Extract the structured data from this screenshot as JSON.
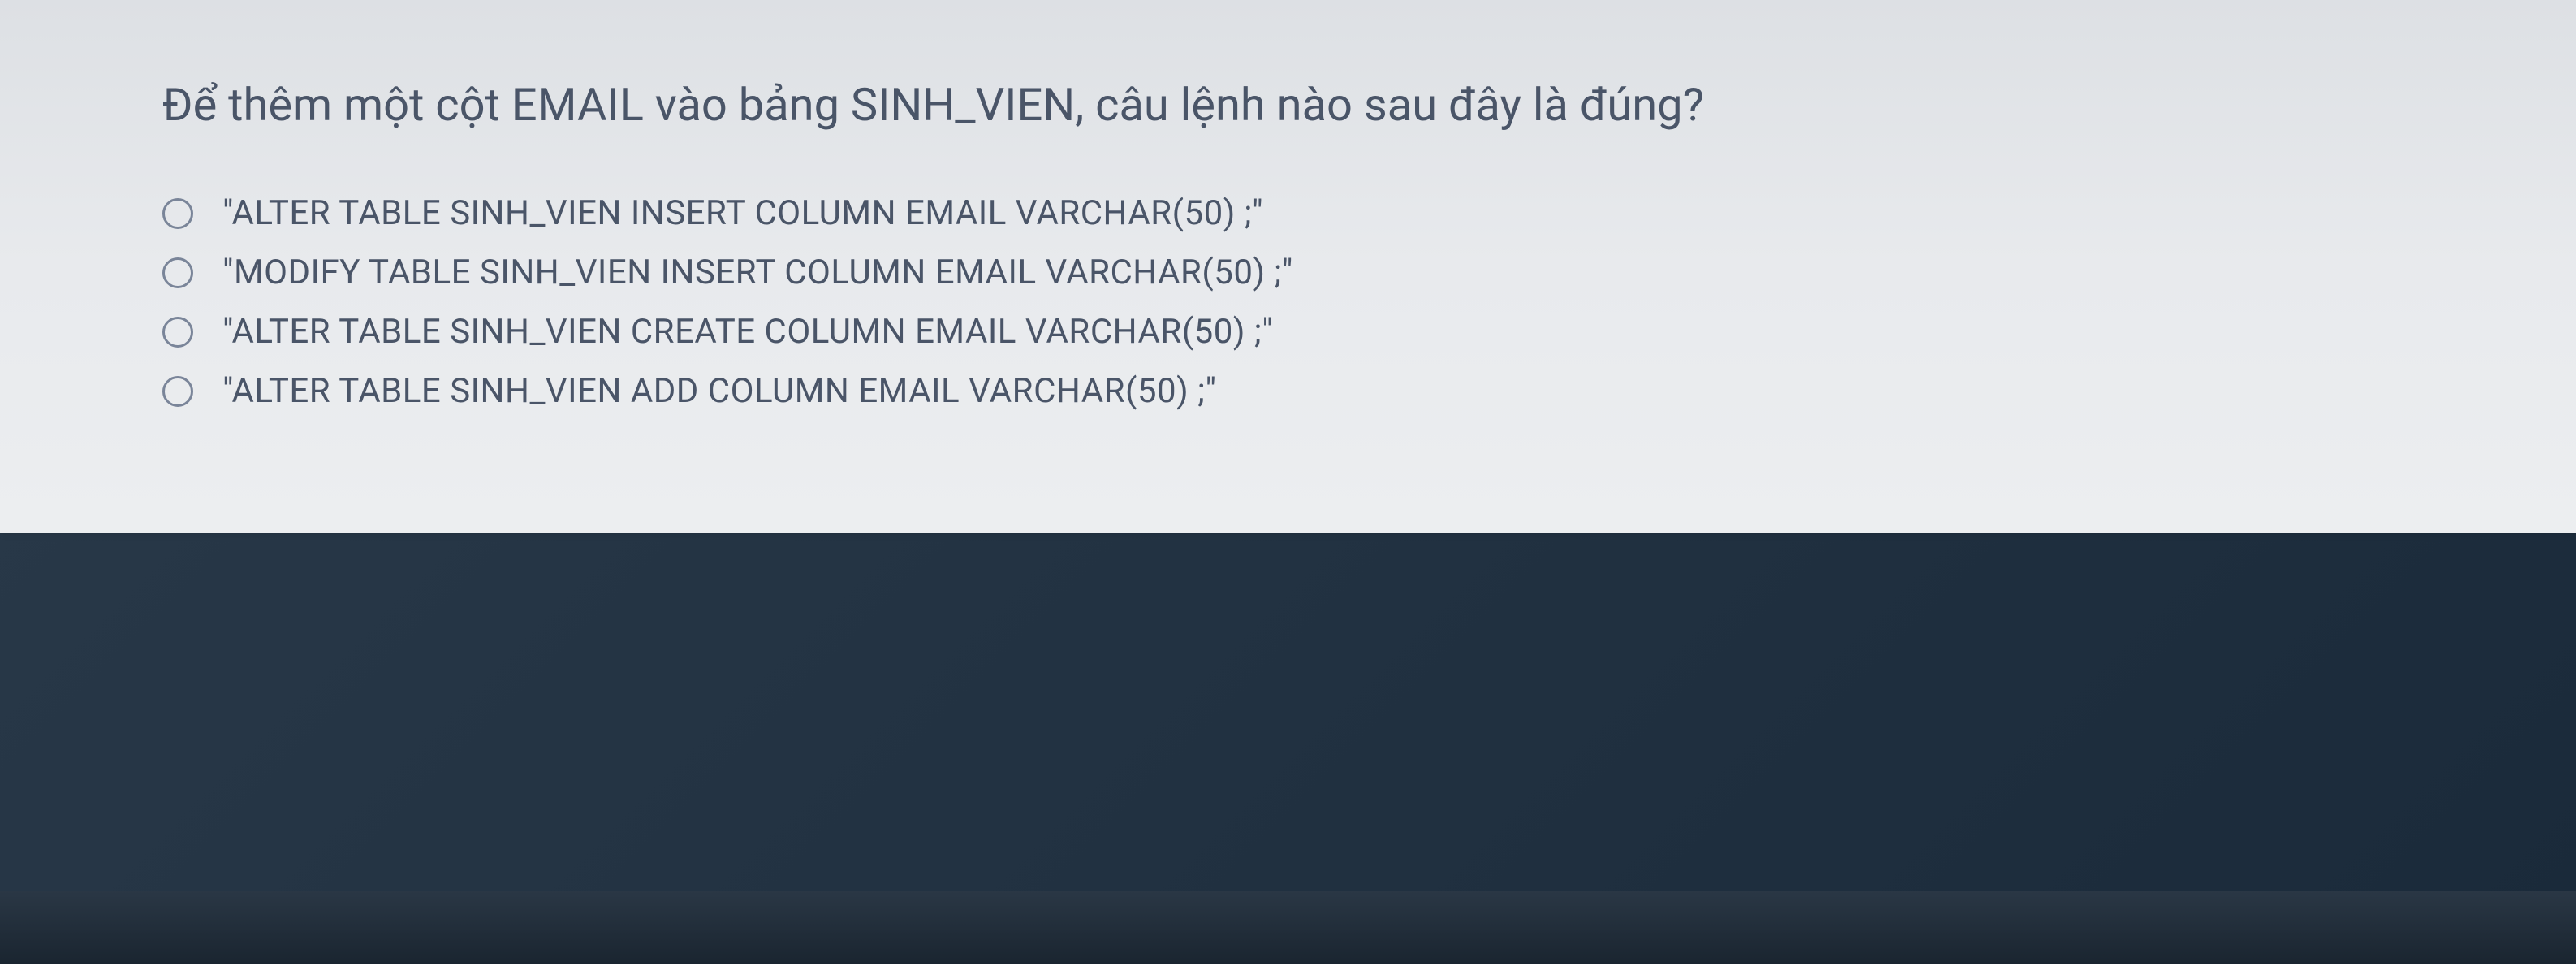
{
  "question": {
    "text": "Để thêm một cột EMAIL vào bảng SINH_VIEN, câu lệnh nào sau đây là đúng?",
    "options": [
      {
        "label": "\"ALTER TABLE SINH_VIEN INSERT COLUMN EMAIL VARCHAR(50) ;\""
      },
      {
        "label": "\"MODIFY TABLE SINH_VIEN INSERT COLUMN EMAIL VARCHAR(50) ;\""
      },
      {
        "label": "\"ALTER TABLE SINH_VIEN CREATE COLUMN EMAIL VARCHAR(50) ;\""
      },
      {
        "label": "\"ALTER TABLE SINH_VIEN ADD COLUMN EMAIL VARCHAR(50) ;\""
      }
    ]
  }
}
